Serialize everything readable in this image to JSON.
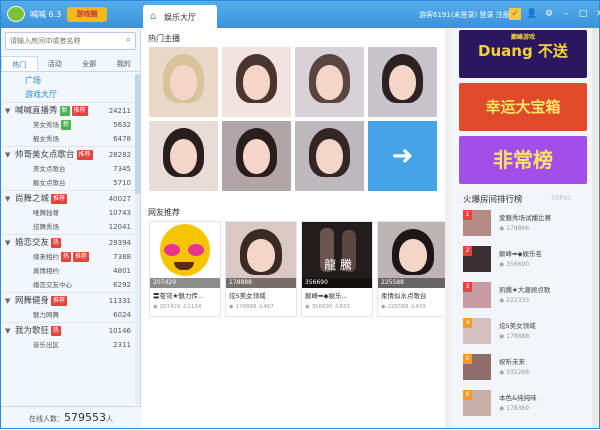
{
  "titlebar": {
    "app_name": "喊喊 6.3",
    "promo": "游戏圈",
    "tab_label": "娱乐大厅",
    "visitor": "游客6191(未登录)",
    "login": "登录",
    "register": "注册"
  },
  "sidebar": {
    "search_placeholder": "请输入房间ID或者名称",
    "tabs": [
      "热门",
      "活动",
      "全部",
      "我的"
    ],
    "categories": [
      "广场",
      "游戏大厅"
    ],
    "groups": [
      {
        "name": "喊喊直播秀",
        "badges": [
          {
            "t": "新",
            "c": "green"
          },
          {
            "t": "推荐",
            "c": "red"
          }
        ],
        "count": "24211",
        "subs": [
          {
            "name": "美女秀场",
            "badges": [
              {
                "t": "新",
                "c": "green"
              }
            ],
            "count": "5632"
          },
          {
            "name": "靓女秀场",
            "badges": [],
            "count": "6478"
          }
        ]
      },
      {
        "name": "帅哥美女点歌台",
        "badges": [
          {
            "t": "推荐",
            "c": "red"
          }
        ],
        "count": "28282",
        "subs": [
          {
            "name": "美女点歌台",
            "badges": [],
            "count": "7345"
          },
          {
            "name": "靓女点歌台",
            "badges": [],
            "count": "5710"
          }
        ]
      },
      {
        "name": "尚舞之城",
        "badges": [
          {
            "t": "推荐",
            "c": "red"
          }
        ],
        "count": "40027",
        "subs": [
          {
            "name": "唯舞独尊",
            "badges": [],
            "count": "10743"
          },
          {
            "name": "炫舞秀场",
            "badges": [],
            "count": "12041"
          }
        ]
      },
      {
        "name": "婚恋交友",
        "badges": [
          {
            "t": "热",
            "c": "red"
          }
        ],
        "count": "29394",
        "subs": [
          {
            "name": "缘来相约",
            "badges": [
              {
                "t": "热",
                "c": "red"
              },
              {
                "t": "推荐",
                "c": "red"
              }
            ],
            "count": "7388"
          },
          {
            "name": "真情相约",
            "badges": [],
            "count": "4801"
          },
          {
            "name": "婚恋交友中心",
            "badges": [],
            "count": "6292"
          }
        ]
      },
      {
        "name": "网舞健身",
        "badges": [
          {
            "t": "推荐",
            "c": "red"
          }
        ],
        "count": "11331",
        "subs": [
          {
            "name": "魅力网舞",
            "badges": [],
            "count": "6024"
          }
        ]
      },
      {
        "name": "我为歌狂",
        "badges": [
          {
            "t": "热",
            "c": "red"
          }
        ],
        "count": "10146",
        "subs": [
          {
            "name": "音乐出区",
            "badges": [],
            "count": "2311"
          }
        ]
      }
    ],
    "online_label": "在线人数：",
    "online_count": "579553",
    "online_unit": "人"
  },
  "main": {
    "hot_title": "热门主播",
    "rec_title": "网友推荐",
    "cards": [
      {
        "num": "207429",
        "title": "〓苍穹★魅力传...",
        "viewers": "207429",
        "fans": "1134"
      },
      {
        "num": "178888",
        "title": "炫S美女领域",
        "viewers": "178888",
        "fans": "467"
      },
      {
        "num": "356690",
        "title": "颠峰➡◆娱乐...",
        "viewers": "356690",
        "fans": "833"
      },
      {
        "num": "225588",
        "title": "柔情似水点歌台",
        "viewers": "225588",
        "fans": "439"
      }
    ],
    "card_overlay_text": "龍 騰"
  },
  "right": {
    "banners": [
      {
        "text": "Duang 不送",
        "sub": "巅峰游戏",
        "bg": "#2a1760",
        "fg": "#f5d23a"
      },
      {
        "text": "幸运大宝箱",
        "sub": "",
        "bg": "#e04a2a",
        "fg": "#ffe566"
      },
      {
        "text": "非常榜",
        "sub": "",
        "bg": "#a24ee8",
        "fg": "#ffe566"
      }
    ],
    "rank_title": "火爆房间排行榜",
    "rank_sub": "TOP10",
    "ranks": [
      {
        "rank": "1",
        "name": "爱魅秀场试播比赛",
        "viewers": "178866"
      },
      {
        "rank": "2",
        "name": "颠峰➡◆娱乐名",
        "viewers": "356690"
      },
      {
        "rank": "3",
        "name": "凯撒★大唐顾点歌",
        "viewers": "222333"
      },
      {
        "rank": "4",
        "name": "炫S美女领域",
        "viewers": "178888"
      },
      {
        "rank": "5",
        "name": "祝听未来",
        "viewers": "332288"
      },
      {
        "rank": "6",
        "name": "本色&纯纯味",
        "viewers": "178369"
      }
    ]
  }
}
